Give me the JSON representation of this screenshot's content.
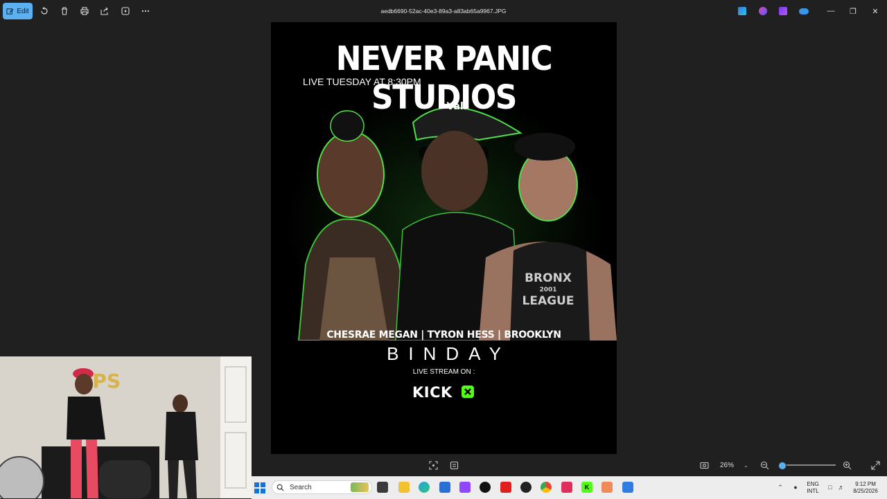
{
  "titlebar": {
    "edit_label": "Edit",
    "filename": "aedb6690-52ac-40e3-89a3-a83ab65a9967.JPG",
    "icons": [
      "edit-icon",
      "rotate-icon",
      "delete-icon",
      "print-icon",
      "share-icon",
      "slideshow-icon",
      "more-icon"
    ],
    "app_icons": [
      "designer-icon",
      "copilot-icon",
      "clipchamp-icon",
      "onedrive-icon"
    ],
    "window_controls": [
      "minimize-icon",
      "restore-icon",
      "close-icon"
    ]
  },
  "poster": {
    "title": "NEVER PANIC STUDIOS",
    "subtitle": "LIVE TUESDAY AT 8:30PM",
    "cap_text": "Vall",
    "shirt_text_1": "BRONX",
    "shirt_text_2": "2001",
    "shirt_text_3": "LEAGUE",
    "names": "CHESRAE MEGAN | TYRON HESS | BROOKLYN",
    "event": "BINDAY",
    "live_stream": "LIVE STREAM ON :",
    "platform": "KICK"
  },
  "webcam": {
    "sign_text": "NPS"
  },
  "bottom_toolbar": {
    "zoom_value": "26%",
    "zoom_percent": 26,
    "icons": [
      "fit-icon",
      "filmstrip-icon",
      "screen-fit-icon",
      "zoom-out-icon",
      "zoom-in-icon",
      "fullscreen-icon"
    ]
  },
  "taskbar": {
    "search_placeholder": "Search",
    "language_top": "ENG",
    "language_bottom": "INTL",
    "time": "9:12 PM",
    "date": "8/25/2026"
  },
  "colors": {
    "accent": "#5ab0f0",
    "kick_green": "#53fc18",
    "app_background": "#202020",
    "taskbar": "#ededed"
  }
}
